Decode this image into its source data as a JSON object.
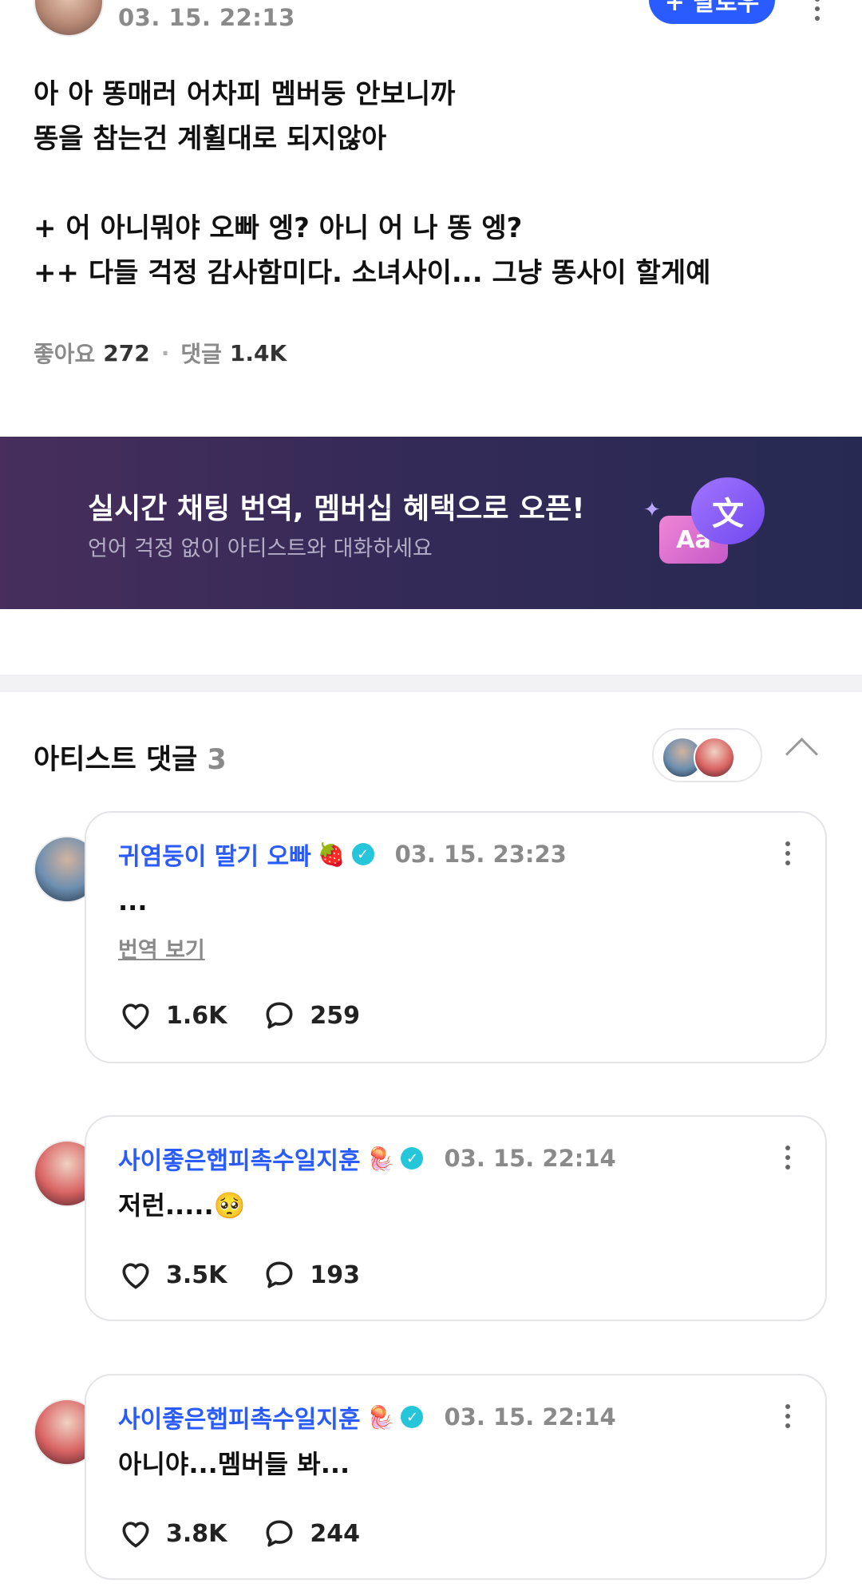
{
  "post": {
    "time": "03. 15. 22:13",
    "follow_label": "+ 팔로우",
    "lines": [
      "아 아 똥매러 어차피 멤버둥 안보니까",
      "똥을 참는건 계휠대로 되지않아",
      "",
      "+ 어 아니뭐야 오빠 엥? 아니 어 나 똥 엥?",
      "++ 다들 걱정 감사함미다. 소녀사이... 그냥 똥사이 할게예"
    ],
    "likes_label": "좋아요",
    "likes": "272",
    "comments_label": "댓글",
    "comments": "1.4K"
  },
  "banner": {
    "title": "실시간 채팅 번역, 멤버십 혜택으로 오픈!",
    "subtitle": "언어 걱정 없이 아티스트와 대화하세요",
    "icon_main": "文",
    "icon_sub": "Aa"
  },
  "artist_section": {
    "title": "아티스트 댓글",
    "count": "3"
  },
  "comments": [
    {
      "name": "귀염둥이 딸기 오빠",
      "emoji": "🍓",
      "time": "03. 15. 23:23",
      "text": "...",
      "translate": "번역 보기",
      "likes": "1.6K",
      "replies": "259"
    },
    {
      "name": "사이좋은햅피촉수일지훈",
      "emoji": "🪼",
      "time": "03. 15. 22:14",
      "text": "저런.....🥺",
      "likes": "3.5K",
      "replies": "193"
    },
    {
      "name": "사이좋은햅피촉수일지훈",
      "emoji": "🪼",
      "time": "03. 15. 22:14",
      "text": "아니야...멤버들 봐...",
      "likes": "3.8K",
      "replies": "244"
    }
  ],
  "colors": {
    "accent": "#2a5bff",
    "verified": "#26c6da",
    "banner_start": "#472e5c",
    "banner_end": "#262a52"
  }
}
